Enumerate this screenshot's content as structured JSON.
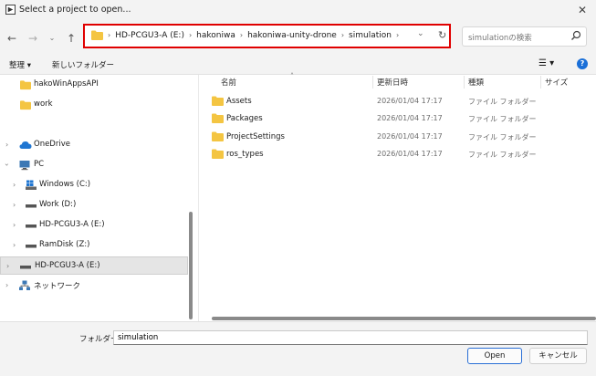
{
  "window": {
    "title": "Select a project to open...",
    "close_glyph": "✕"
  },
  "address_bar": {
    "segments": [
      "HD-PCGU3-A (E:)",
      "hakoniwa",
      "hakoniwa-unity-drone",
      "simulation"
    ],
    "separator": "›"
  },
  "search": {
    "placeholder": "simulationの検索"
  },
  "toolbar": {
    "organize_label": "整理",
    "new_folder_label": "新しいフォルダー"
  },
  "nav_pane": {
    "items": [
      {
        "label": "hakoWinAppsAPI",
        "icon": "folder-icon"
      },
      {
        "label": "work",
        "icon": "folder-icon"
      },
      {
        "label": "OneDrive",
        "icon": "cloud-icon"
      },
      {
        "label": "PC",
        "icon": "computer-icon"
      },
      {
        "label": "Windows (C:)",
        "icon": "windows-drive-icon"
      },
      {
        "label": "Work (D:)",
        "icon": "drive-icon"
      },
      {
        "label": "HD-PCGU3-A (E:)",
        "icon": "drive-icon"
      },
      {
        "label": "RamDisk (Z:)",
        "icon": "drive-icon"
      },
      {
        "label": "HD-PCGU3-A (E:)",
        "icon": "drive-icon",
        "selected": true
      },
      {
        "label": "ネットワーク",
        "icon": "network-icon"
      }
    ]
  },
  "file_list": {
    "columns": {
      "name": "名前",
      "date": "更新日時",
      "type": "種類",
      "size": "サイズ"
    },
    "rows": [
      {
        "name": "Assets",
        "date": "2026/01/04 17:17",
        "type": "ファイル フォルダー"
      },
      {
        "name": "Packages",
        "date": "2026/01/04 17:17",
        "type": "ファイル フォルダー"
      },
      {
        "name": "ProjectSettings",
        "date": "2026/01/04 17:17",
        "type": "ファイル フォルダー"
      },
      {
        "name": "ros_types",
        "date": "2026/01/04 17:17",
        "type": "ファイル フォルダー"
      }
    ]
  },
  "footer": {
    "folder_label": "フォルダー:",
    "folder_value": "simulation",
    "open_label": "Open",
    "cancel_label": "キャンセル"
  },
  "colors": {
    "accent": "#2a6fd6",
    "highlight": "#e00000",
    "folder": "#f4c542"
  }
}
